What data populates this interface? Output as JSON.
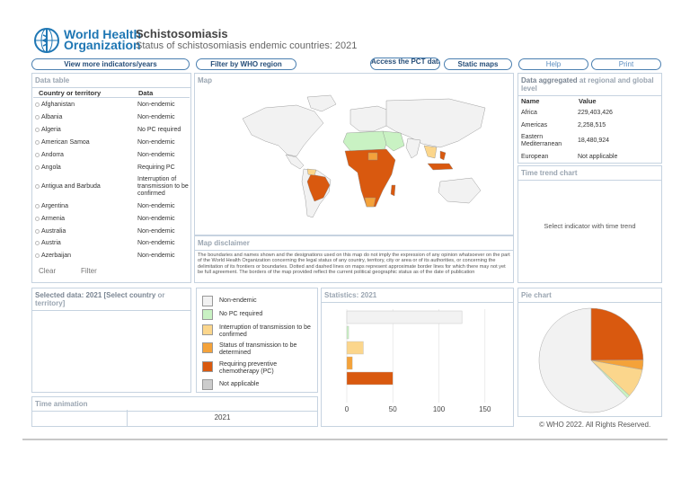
{
  "header": {
    "org_line1": "World Health",
    "org_line2": "Organization",
    "title": "Schistosomiasis",
    "subtitle": "Status of schistosomiasis endemic countries: 2021"
  },
  "toolbar": {
    "more_indicators": "View more indicators/years",
    "filter_region": "Filter by WHO region",
    "pct_databank": "Access the PCT databank",
    "static_maps": "Static maps",
    "help": "Help",
    "print": "Print"
  },
  "data_table": {
    "title": "Data table",
    "col1": "Country or territory",
    "col2": "Data",
    "rows": [
      {
        "country": "Afghanistan",
        "data": "Non-endemic"
      },
      {
        "country": "Albania",
        "data": "Non-endemic"
      },
      {
        "country": "Algeria",
        "data": "No PC required"
      },
      {
        "country": "American Samoa",
        "data": "Non-endemic"
      },
      {
        "country": "Andorra",
        "data": "Non-endemic"
      },
      {
        "country": "Angola",
        "data": "Requiring PC"
      },
      {
        "country": "Antigua and Barbuda",
        "data": "Interruption of transmission to be confirmed"
      },
      {
        "country": "Argentina",
        "data": "Non-endemic"
      },
      {
        "country": "Armenia",
        "data": "Non-endemic"
      },
      {
        "country": "Australia",
        "data": "Non-endemic"
      },
      {
        "country": "Austria",
        "data": "Non-endemic"
      },
      {
        "country": "Azerbaijan",
        "data": "Non-endemic"
      }
    ],
    "clear": "Clear",
    "filter": "Filter"
  },
  "map": {
    "title": "Map",
    "disclaimer_title": "Map disclaimer",
    "disclaimer_text": "The boundaries and names shown and the designations used on this map do not imply the expression of any opinion whatsoever on the part of the World Health Organization concerning the legal status of any country, territory, city or area or of its authorities, or concerning the delimitation of its frontiers or boundaries. Dotted and dashed lines on maps represent approximate border lines for which there may not yet be full agreement. The borders of the map provided reflect the current political geographic status as of the date of publication"
  },
  "aggregated": {
    "title_a": "Data aggregated",
    "title_b": " at regional and global level",
    "col1": "Name",
    "col2": "Value",
    "rows": [
      {
        "name": "Africa",
        "value": "229,403,426"
      },
      {
        "name": "Americas",
        "value": "2,258,515"
      },
      {
        "name": "Eastern Mediterranean",
        "value": "18,480,924"
      },
      {
        "name": "European",
        "value": "Not applicable"
      }
    ]
  },
  "time_trend": {
    "title": "Time trend chart",
    "message": "Select indicator with time trend"
  },
  "selected": {
    "title_a": "Selected data: 2021 [Select country",
    "title_b": " or territory]"
  },
  "legend": {
    "items": [
      {
        "label": "Non-endemic",
        "color": "#f2f2f2"
      },
      {
        "label": "No PC required",
        "color": "#c9f2c3"
      },
      {
        "label": "Interruption of transmission to be confirmed",
        "color": "#fbd68c"
      },
      {
        "label": "Status of transmission to be determined",
        "color": "#f4a23a"
      },
      {
        "label": "Requiring preventive chemotherapy (PC)",
        "color": "#d9590f"
      },
      {
        "label": "Not applicable",
        "color": "#cccccc"
      }
    ]
  },
  "statistics": {
    "title": "Statistics: 2021"
  },
  "pie": {
    "title": "Pie chart"
  },
  "time_animation": {
    "title": "Time animation",
    "year": "2021"
  },
  "footer": {
    "copyright": "© WHO 2022. All Rights Reserved."
  },
  "chart_data": [
    {
      "type": "bar",
      "orientation": "horizontal",
      "title": "Statistics: 2021",
      "categories": [
        "Non-endemic",
        "No PC required",
        "Interruption of transmission to be confirmed",
        "Status of transmission to be determined",
        "Requiring preventive chemotherapy (PC)",
        "Not applicable"
      ],
      "values": [
        125,
        2,
        18,
        6,
        50,
        0
      ],
      "colors": [
        "#f2f2f2",
        "#c9f2c3",
        "#fbd68c",
        "#f4a23a",
        "#d9590f",
        "#cccccc"
      ],
      "xlim": [
        0,
        160
      ],
      "xticks": [
        0,
        50,
        100,
        150
      ]
    },
    {
      "type": "pie",
      "title": "Pie chart",
      "labels": [
        "Non-endemic",
        "No PC required",
        "Interruption of transmission to be confirmed",
        "Status of transmission to be determined",
        "Requiring preventive chemotherapy (PC)",
        "Not applicable"
      ],
      "values": [
        125,
        2,
        18,
        6,
        50,
        0
      ],
      "colors": [
        "#f2f2f2",
        "#c9f2c3",
        "#fbd68c",
        "#f4a23a",
        "#d9590f",
        "#cccccc"
      ]
    }
  ]
}
